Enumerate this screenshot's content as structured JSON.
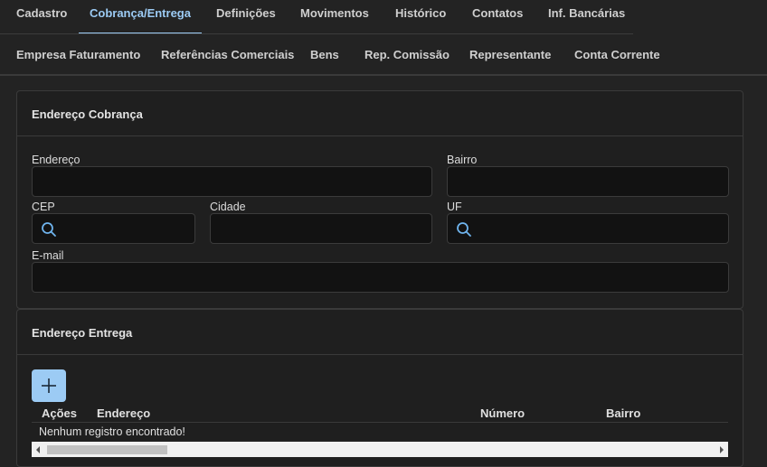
{
  "tabs_primary": [
    "Cadastro",
    "Cobrança/Entrega",
    "Definições",
    "Movimentos",
    "Histórico",
    "Contatos",
    "Inf. Bancárias"
  ],
  "tabs_secondary": [
    "Empresa Faturamento",
    "Referências Comerciais",
    "Bens",
    "Rep. Comissão",
    "Representante",
    "Conta Corrente"
  ],
  "cobranca": {
    "title": "Endereço Cobrança",
    "endereco_label": "Endereço",
    "endereco_value": "",
    "bairro_label": "Bairro",
    "bairro_value": "",
    "cep_label": "CEP",
    "cep_value": "",
    "cidade_label": "Cidade",
    "cidade_value": "",
    "uf_label": "UF",
    "uf_value": "",
    "email_label": "E-mail",
    "email_value": ""
  },
  "entrega": {
    "title": "Endereço Entrega",
    "add_icon": "plus-icon",
    "columns": [
      "Ações",
      "Endereço",
      "Número",
      "Bairro"
    ],
    "empty_message": "Nenhum registro encontrado!"
  },
  "colors": {
    "accent": "#9ccbf4",
    "background": "#232323",
    "field_bg": "#121212"
  }
}
